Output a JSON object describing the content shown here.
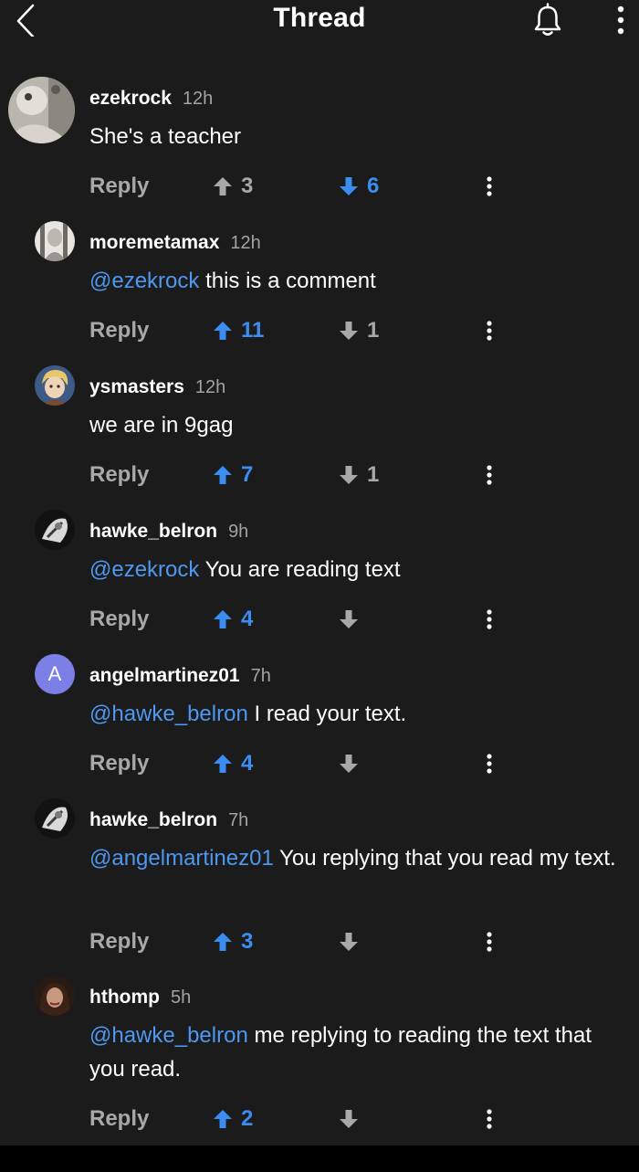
{
  "header": {
    "title": "Thread"
  },
  "colors": {
    "background": "#1b1b1b",
    "mention": "#4d98f1",
    "vote_active": "#3b8ef1",
    "muted": "#a8a8a8"
  },
  "comments": [
    {
      "username": "ezekrock",
      "time": "12h",
      "mention": "",
      "text": "She's a teacher",
      "reply_label": "Reply",
      "upvotes": "3",
      "downvotes": "6",
      "active_vote": "down",
      "avatar": "photo-avatar"
    },
    {
      "username": "moremetamax",
      "time": "12h",
      "mention": "@ezekrock",
      "text": " this is a comment",
      "reply_label": "Reply",
      "upvotes": "11",
      "downvotes": "1",
      "active_vote": "up",
      "avatar": "photo-avatar"
    },
    {
      "username": "ysmasters",
      "time": "12h",
      "mention": "",
      "text": "we are in 9gag",
      "reply_label": "Reply",
      "upvotes": "7",
      "downvotes": "1",
      "active_vote": "up",
      "avatar": "cartoon-avatar"
    },
    {
      "username": "hawke_belron",
      "time": "9h",
      "mention": "@ezekrock",
      "text": " You are reading text",
      "reply_label": "Reply",
      "upvotes": "4",
      "downvotes": "",
      "active_vote": "up",
      "avatar": "photo-avatar"
    },
    {
      "username": "angelmartinez01",
      "time": "7h",
      "mention": "@hawke_belron",
      "text": " I read your text.",
      "reply_label": "Reply",
      "upvotes": "4",
      "downvotes": "",
      "active_vote": "up",
      "avatar": "letter-avatar",
      "avatar_letter": "A"
    },
    {
      "username": "hawke_belron",
      "time": "7h",
      "mention": "@angelmartinez01",
      "text": " You replying that you read my text.",
      "reply_label": "Reply",
      "upvotes": "3",
      "downvotes": "",
      "active_vote": "up",
      "avatar": "photo-avatar"
    },
    {
      "username": "hthomp",
      "time": "5h",
      "mention": "@hawke_belron",
      "text": " me replying to reading the text that you read.",
      "reply_label": "Reply",
      "upvotes": "2",
      "downvotes": "",
      "active_vote": "up",
      "avatar": "photo-avatar"
    }
  ]
}
